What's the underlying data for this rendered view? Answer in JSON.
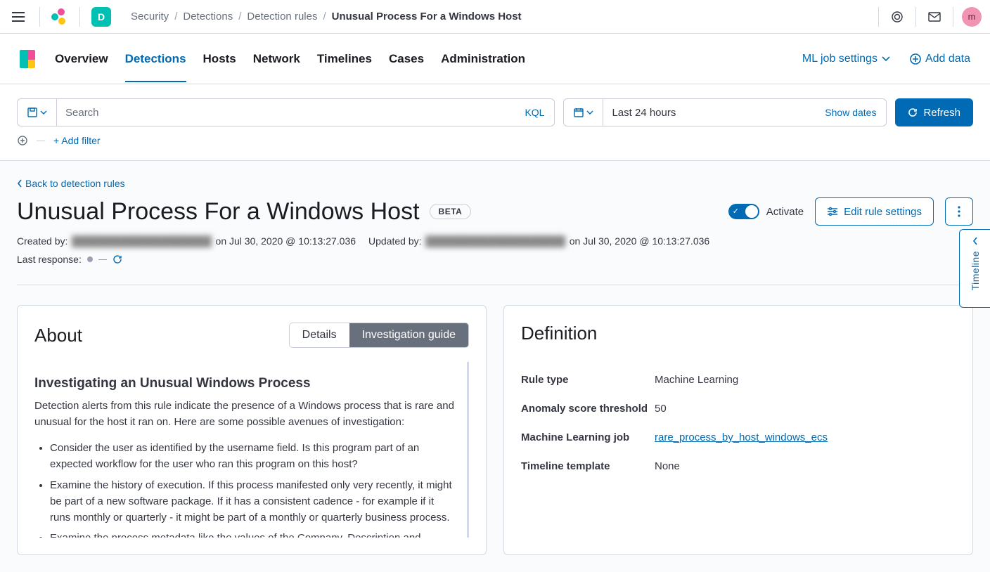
{
  "breadcrumbs": {
    "items": [
      "Security",
      "Detections",
      "Detection rules"
    ],
    "current": "Unusual Process For a Windows Host"
  },
  "space_letter": "D",
  "avatar_letter": "m",
  "nav": {
    "tabs": [
      "Overview",
      "Detections",
      "Hosts",
      "Network",
      "Timelines",
      "Cases",
      "Administration"
    ],
    "active_index": 1,
    "ml_settings": "ML job settings",
    "add_data": "Add data"
  },
  "search": {
    "placeholder": "Search",
    "kql": "KQL",
    "date_label": "Last 24 hours",
    "show_dates": "Show dates",
    "refresh": "Refresh",
    "add_filter": "+ Add filter"
  },
  "back_link": "Back to detection rules",
  "rule": {
    "title": "Unusual Process For a Windows Host",
    "beta": "BETA",
    "activate": "Activate",
    "edit": "Edit rule settings",
    "created_by_label": "Created by:",
    "created_user_masked": "████████████████████",
    "created_on": "on Jul 30, 2020 @ 10:13:27.036",
    "updated_by_label": "Updated by:",
    "updated_user_masked": "████████████████████",
    "updated_on": "on Jul 30, 2020 @ 10:13:27.036",
    "last_response_label": "Last response:"
  },
  "about": {
    "title": "About",
    "tabs": {
      "details": "Details",
      "guide": "Investigation guide"
    },
    "guide_heading": "Investigating an Unusual Windows Process",
    "guide_intro": "Detection alerts from this rule indicate the presence of a Windows process that is rare and unusual for the host it ran on. Here are some possible avenues of investigation:",
    "guide_items": [
      "Consider the user as identified by the username field. Is this program part of an expected workflow for the user who ran this program on this host?",
      "Examine the history of execution. If this process manifested only very recently, it might be part of a new software package. If it has a consistent cadence - for example if it runs monthly or quarterly - it might be part of a monthly or quarterly business process.",
      "Examine the process metadata like the values of the Company, Description and"
    ]
  },
  "definition": {
    "title": "Definition",
    "rows": [
      {
        "label": "Rule type",
        "value": "Machine Learning",
        "link": false
      },
      {
        "label": "Anomaly score threshold",
        "value": "50",
        "link": false
      },
      {
        "label": "Machine Learning job",
        "value": "rare_process_by_host_windows_ecs",
        "link": true
      },
      {
        "label": "Timeline template",
        "value": "None",
        "link": false
      }
    ]
  },
  "timeline_flyout": "Timeline"
}
